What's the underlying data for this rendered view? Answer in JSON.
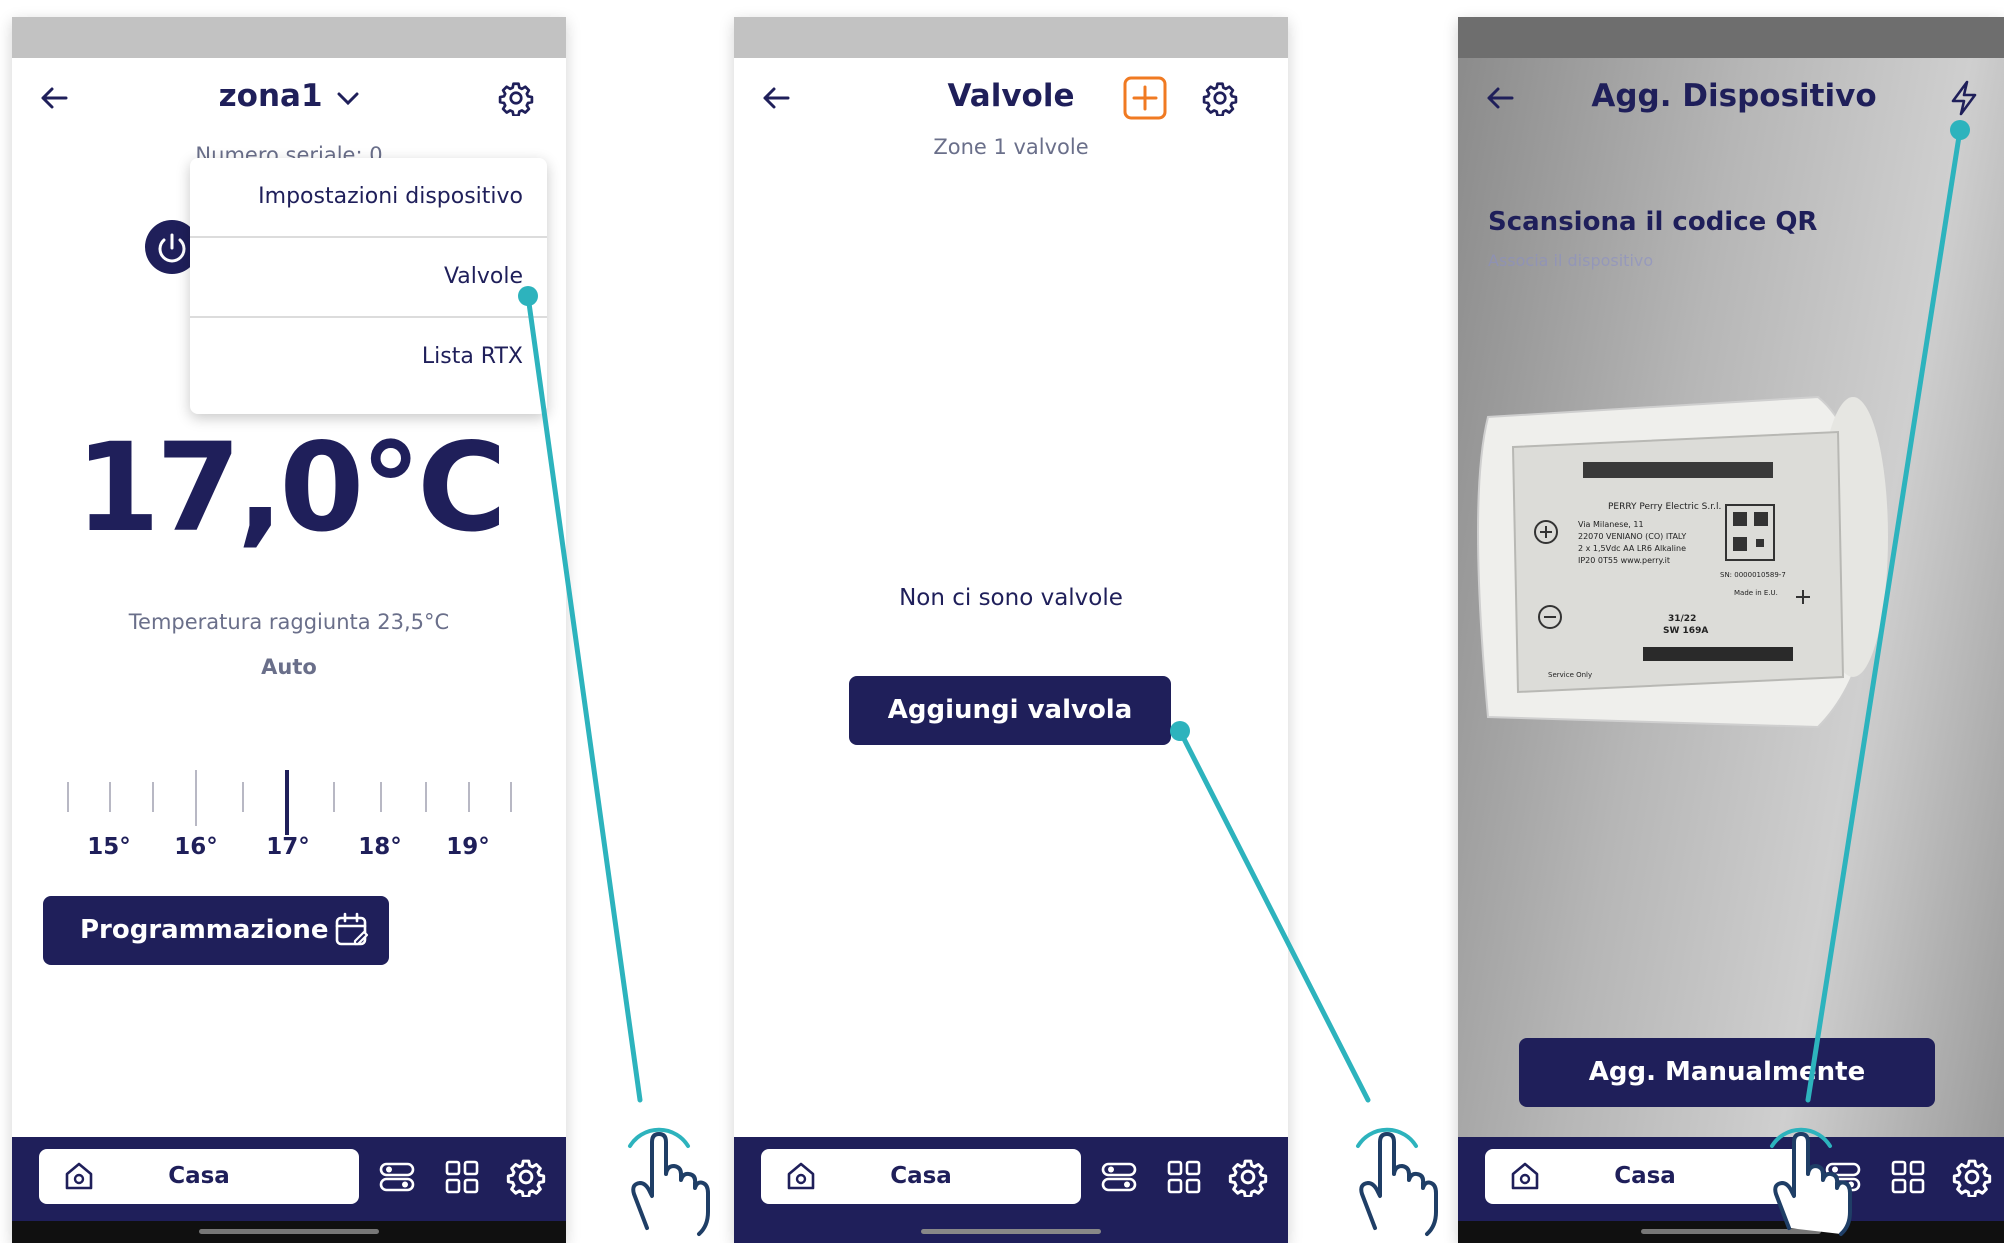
{
  "colors": {
    "primary": "#1f1f5a",
    "accent": "#f07a22",
    "highlight": "#2db3bd",
    "statusbar": "#c2c2c2"
  },
  "screen1": {
    "zone_title": "zona1",
    "serial": "Numero seriale: 0",
    "menu": [
      "Impostazioni dispositivo",
      "Valvole",
      "Lista RTX"
    ],
    "temperature": "17,0°C",
    "reached": "Temperatura raggiunta 23,5°C",
    "mode": "Auto",
    "scale_labels": [
      "15°",
      "16°",
      "17°",
      "18°",
      "19°"
    ],
    "schedule_button": "Programmazione",
    "icons": [
      "back-arrow-icon",
      "chevron-down-icon",
      "gear-icon",
      "power-icon",
      "calendar-edit-icon"
    ]
  },
  "screen2": {
    "title": "Valvole",
    "subtitle": "Zone 1 valvole",
    "empty_message": "Non ci sono valvole",
    "add_button": "Aggiungi valvola",
    "icons": [
      "back-arrow-icon",
      "add-square-icon",
      "gear-icon"
    ]
  },
  "screen3": {
    "title": "Agg. Dispositivo",
    "scan_title": "Scansiona il codice QR",
    "scan_subtitle": "Associa il dispositivo",
    "manual_button": "Agg. Manualmente",
    "device_label": {
      "brand": "PERRY Perry Electric S.r.l.",
      "address": "Via Milanese, 11",
      "city": "22070 VENIANO (CO) ITALY",
      "power": "2 x 1,5Vdc AA LR6 Alkaline",
      "rating": "IP20  0T55    www.perry.it",
      "serial": "SN: 0000010589-7",
      "made": "Made in E.U.",
      "date": "31/22",
      "sw": "SW 169A",
      "service": "Service Only"
    },
    "icons": [
      "back-arrow-icon",
      "flash-icon"
    ]
  },
  "navbar": {
    "home_label": "Casa",
    "icons": [
      "home-icon",
      "toggles-icon",
      "grid-icon",
      "gear-icon"
    ]
  }
}
